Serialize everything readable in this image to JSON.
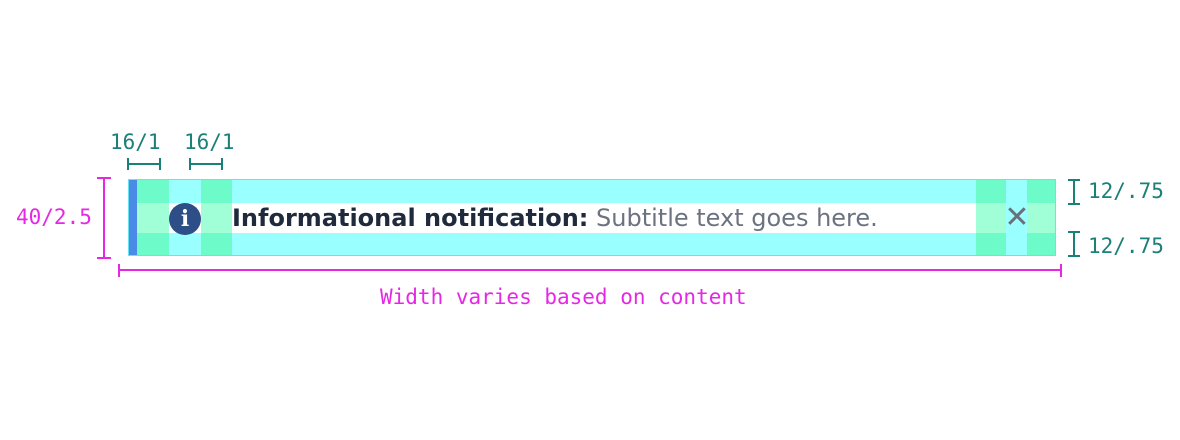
{
  "annotations": {
    "left_padding": "16/1",
    "icon_gap": "16/1",
    "height": "40/2.5",
    "top_padding": "12/.75",
    "bottom_padding": "12/.75",
    "width_note": "Width varies based on content"
  },
  "notification": {
    "title": "Informational notification:",
    "subtitle": "Subtitle text goes here.",
    "close_glyph": "✕",
    "info_glyph": "i"
  },
  "colors": {
    "accent": "#4b8be8",
    "info_icon": "#2d4e86",
    "spacing": "#1b8077",
    "dimension": "#e628e6",
    "padding_fill": "#99ffff",
    "padding_green": "#a0ffd6"
  }
}
